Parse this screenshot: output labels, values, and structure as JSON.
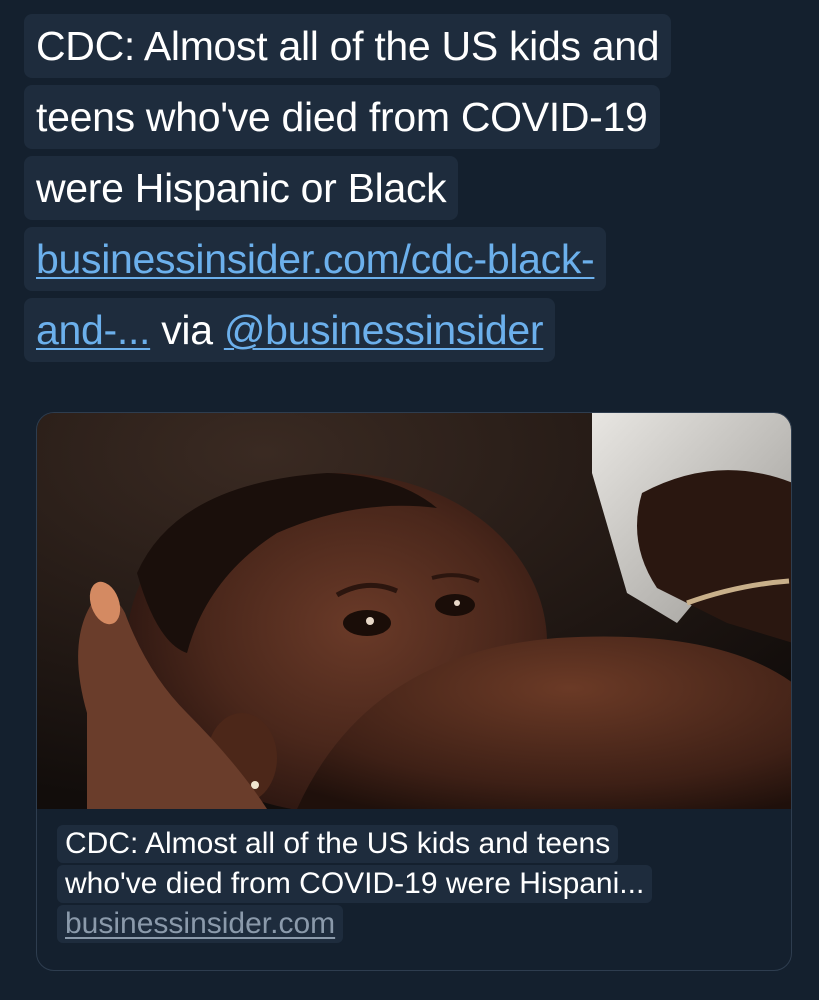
{
  "tweet": {
    "text_lines": [
      "CDC: Almost all of the US kids and",
      "teens who've died from COVID-19",
      "were Hispanic or Black"
    ],
    "link_line1": "businessinsider.com/cdc-black-",
    "link_line2": "and-...",
    "via_text": " via ",
    "mention": "@businessinsider"
  },
  "card": {
    "title_line1": "CDC: Almost all of the US kids and teens",
    "title_line2": "who've died from COVID-19 were Hispani...",
    "domain": "businessinsider.com",
    "image_subject": "child-being-held-photo"
  },
  "colors": {
    "background": "#14202e",
    "text_highlight": "#1e2c3d",
    "link": "#6cb0ec",
    "card_border": "#2e3d4f",
    "domain": "#8b9aab"
  }
}
